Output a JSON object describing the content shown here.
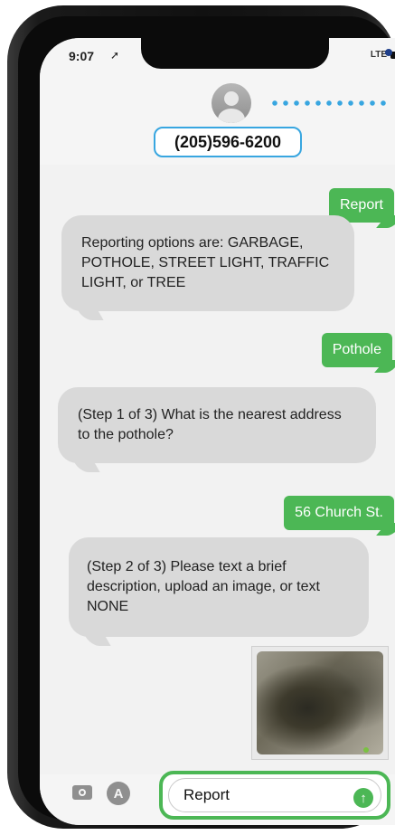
{
  "status_bar": {
    "time": "9:07",
    "location_glyph": "➚",
    "network": "LTE"
  },
  "contact": {
    "phone_number": "(205)596-6200"
  },
  "messages": [
    {
      "direction": "outgoing",
      "text": "Report"
    },
    {
      "direction": "incoming",
      "text": "Reporting options are: GARBAGE, POTHOLE, STREET LIGHT, TRAFFIC LIGHT, or TREE"
    },
    {
      "direction": "outgoing",
      "text": "Pothole"
    },
    {
      "direction": "incoming",
      "text": "(Step 1 of 3) What is the nearest address to the pothole?"
    },
    {
      "direction": "outgoing",
      "text": "56 Church St."
    },
    {
      "direction": "incoming",
      "text": "(Step 2 of 3) Please text a brief description, upload an image, or text NONE"
    },
    {
      "direction": "outgoing",
      "type": "image"
    }
  ],
  "compose": {
    "value": "Report",
    "send_glyph": "↑",
    "apps_glyph": "A"
  },
  "colors": {
    "outgoing_bubble": "#4cb755",
    "incoming_bubble": "#d9d9d9",
    "highlight_blue": "#38a6e0",
    "highlight_green": "#4cb755"
  }
}
